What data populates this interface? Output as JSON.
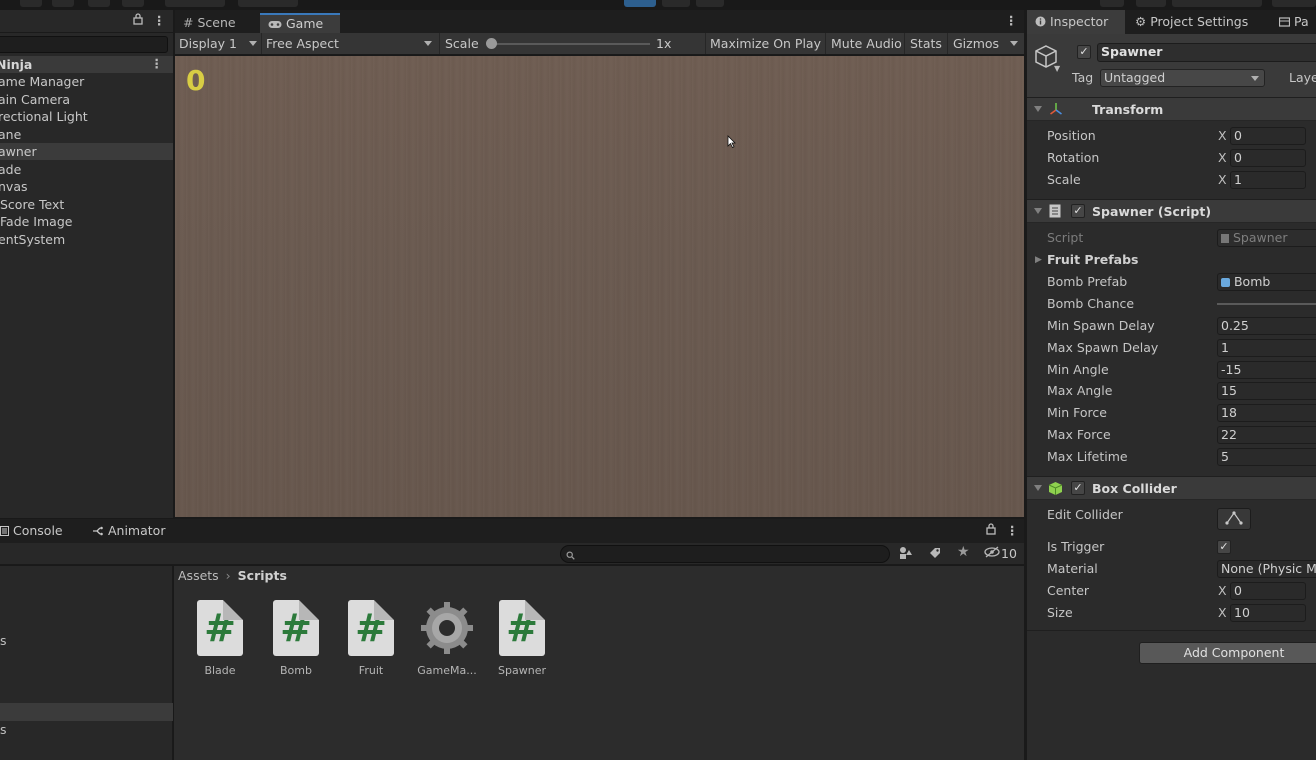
{
  "hierarchy": {
    "scene_name": "Ninja",
    "items": [
      {
        "label": "ame Manager",
        "selected": false
      },
      {
        "label": "ain Camera",
        "selected": false
      },
      {
        "label": "rectional Light",
        "selected": false
      },
      {
        "label": "ane",
        "selected": false
      },
      {
        "label": "awner",
        "selected": true
      },
      {
        "label": "ade",
        "selected": false
      },
      {
        "label": "nvas",
        "selected": false
      },
      {
        "label": "Score Text",
        "selected": false
      },
      {
        "label": "Fade Image",
        "selected": false
      },
      {
        "label": "entSystem",
        "selected": false
      }
    ]
  },
  "view": {
    "tabs": [
      {
        "label": "Scene",
        "icon": "grid-icon",
        "active": false
      },
      {
        "label": "Game",
        "icon": "gamepad-icon",
        "active": true
      }
    ],
    "gamebar": {
      "display": "Display 1",
      "aspect": "Free Aspect",
      "scale_label": "Scale",
      "scale_value": "1x",
      "maximize": "Maximize On Play",
      "mute": "Mute Audio",
      "stats": "Stats",
      "gizmos": "Gizmos"
    },
    "score": "0"
  },
  "bottom": {
    "tabs": [
      {
        "label": "Console",
        "icon": "console-icon"
      },
      {
        "label": "Animator",
        "icon": "animator-icon"
      }
    ],
    "hidden_count": "10",
    "left_items": [
      "s",
      "s"
    ],
    "breadcrumb": {
      "root": "Assets",
      "current": "Scripts"
    },
    "assets": [
      {
        "name": "Blade",
        "type": "script"
      },
      {
        "name": "Bomb",
        "type": "script"
      },
      {
        "name": "Fruit",
        "type": "script"
      },
      {
        "name": "GameMa...",
        "type": "gear"
      },
      {
        "name": "Spawner",
        "type": "script"
      }
    ]
  },
  "inspector": {
    "tabs": [
      {
        "label": "Inspector",
        "icon": "info-icon",
        "active": true
      },
      {
        "label": "Project Settings",
        "icon": "gear-icon",
        "active": false
      },
      {
        "label": "Pa",
        "icon": "package-icon",
        "active": false
      }
    ],
    "object_name": "Spawner",
    "tag_label": "Tag",
    "tag_value": "Untagged",
    "layer_label": "Laye",
    "transform": {
      "title": "Transform",
      "rows": [
        {
          "label": "Position",
          "axis": "X",
          "value": "0"
        },
        {
          "label": "Rotation",
          "axis": "X",
          "value": "0"
        },
        {
          "label": "Scale",
          "axis": "X",
          "value": "1"
        }
      ]
    },
    "spawner": {
      "title": "Spawner (Script)",
      "script_label": "Script",
      "script_value": "Spawner",
      "fruit_prefabs": "Fruit Prefabs",
      "bomb_prefab_label": "Bomb Prefab",
      "bomb_prefab_value": "Bomb",
      "bomb_chance_label": "Bomb Chance",
      "rows": [
        {
          "label": "Min Spawn Delay",
          "value": "0.25"
        },
        {
          "label": "Max Spawn Delay",
          "value": "1"
        },
        {
          "label": "Min Angle",
          "value": "-15"
        },
        {
          "label": "Max Angle",
          "value": "15"
        },
        {
          "label": "Min Force",
          "value": "18"
        },
        {
          "label": "Max Force",
          "value": "22"
        },
        {
          "label": "Max Lifetime",
          "value": "5"
        }
      ]
    },
    "box_collider": {
      "title": "Box Collider",
      "edit_collider": "Edit Collider",
      "is_trigger": "Is Trigger",
      "material_label": "Material",
      "material_value": "None (Physic M",
      "center_label": "Center",
      "center_axis": "X",
      "center_value": "0",
      "size_label": "Size",
      "size_axis": "X",
      "size_value": "10"
    },
    "add_component": "Add Component"
  },
  "colors": {
    "accent": "#3a79bb",
    "score": "#d8cd44",
    "hash_green": "#2c7a3b"
  }
}
